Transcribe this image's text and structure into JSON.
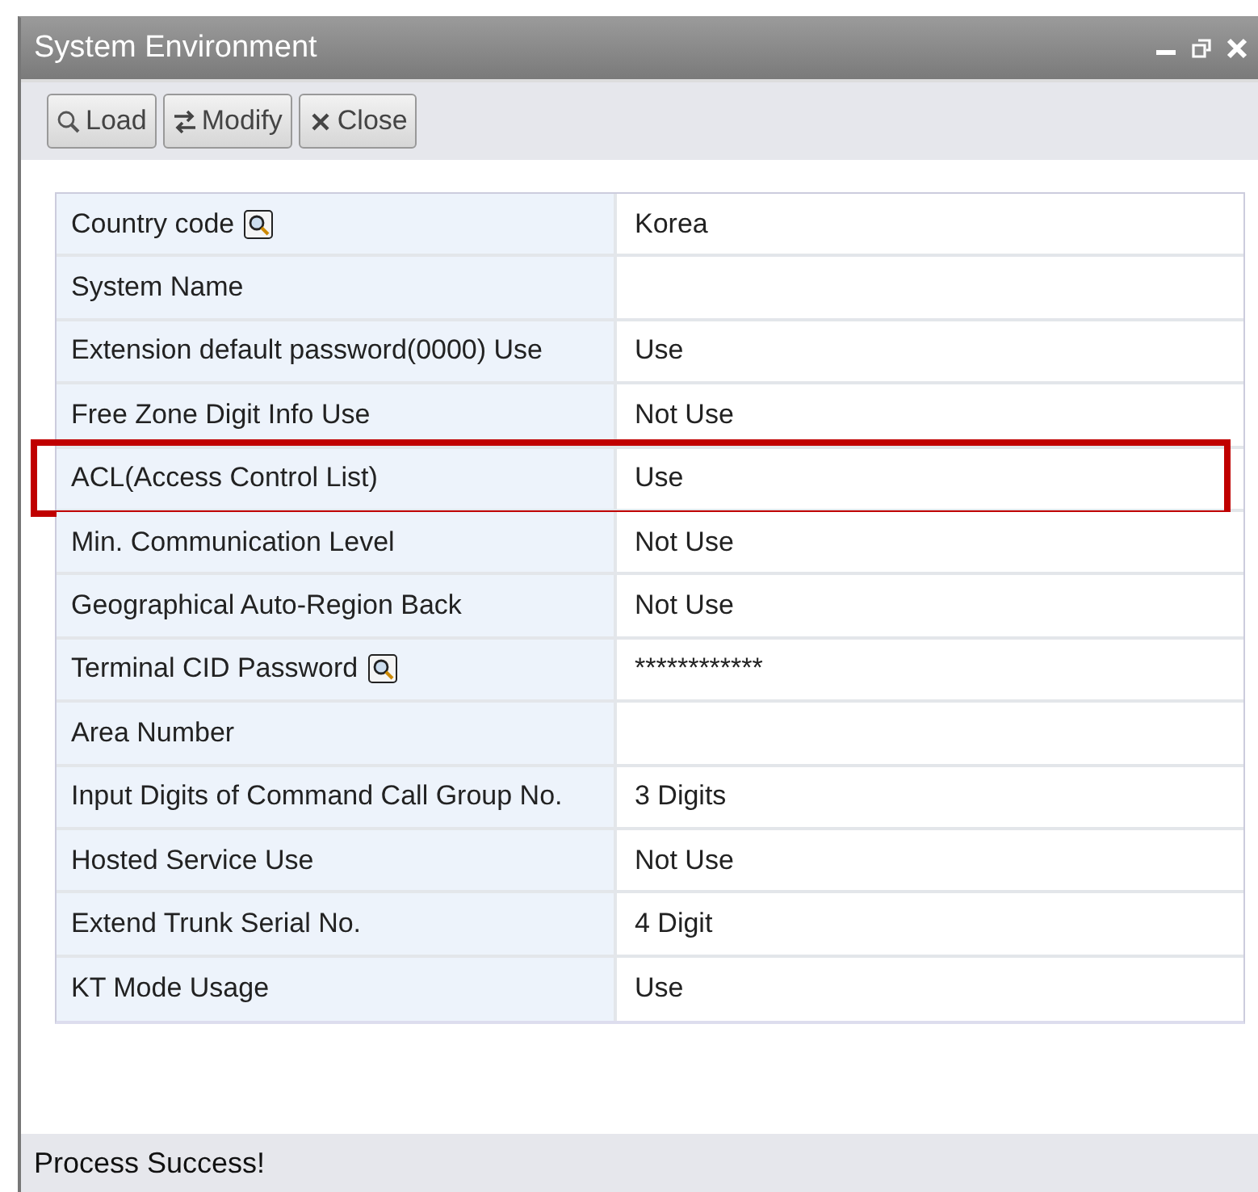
{
  "window": {
    "title": "System Environment"
  },
  "toolbar": [
    {
      "label": "Load"
    },
    {
      "label": "Modify"
    },
    {
      "label": "Close"
    }
  ],
  "rows": [
    {
      "label": "Country code",
      "value": "Korea",
      "lookup": true,
      "highlighted": false
    },
    {
      "label": "System Name",
      "lookup": false,
      "highlighted": false
    },
    {
      "label": "Extension default password(0000) Use",
      "value": "Use",
      "lookup": false,
      "highlighted": false
    },
    {
      "label": "Free Zone Digit Info Use",
      "value": "Not Use",
      "lookup": false,
      "highlighted": false
    },
    {
      "label": "ACL(Access Control List)",
      "value": "Use",
      "lookup": false,
      "highlighted": true
    },
    {
      "label": "Min. Communication Level",
      "value": "Not Use",
      "lookup": false,
      "highlighted": false
    },
    {
      "label": "Geographical Auto-Region Back",
      "value": "Not Use",
      "lookup": false,
      "highlighted": false
    },
    {
      "label": "Terminal CID Password",
      "value": "************",
      "lookup": true,
      "highlighted": false
    },
    {
      "label": "Area Number",
      "lookup": false,
      "highlighted": false
    },
    {
      "label": "Input Digits of Command Call Group No.",
      "value": "3 Digits",
      "lookup": false,
      "highlighted": false
    },
    {
      "label": "Hosted Service Use",
      "value": "Not Use",
      "lookup": false,
      "highlighted": false
    },
    {
      "label": "Extend Trunk Serial No.",
      "value": "4 Digit",
      "lookup": false,
      "highlighted": false
    },
    {
      "label": "KT Mode Usage",
      "value": "Use",
      "lookup": false,
      "highlighted": false
    }
  ],
  "status_bar": "Process Success!"
}
